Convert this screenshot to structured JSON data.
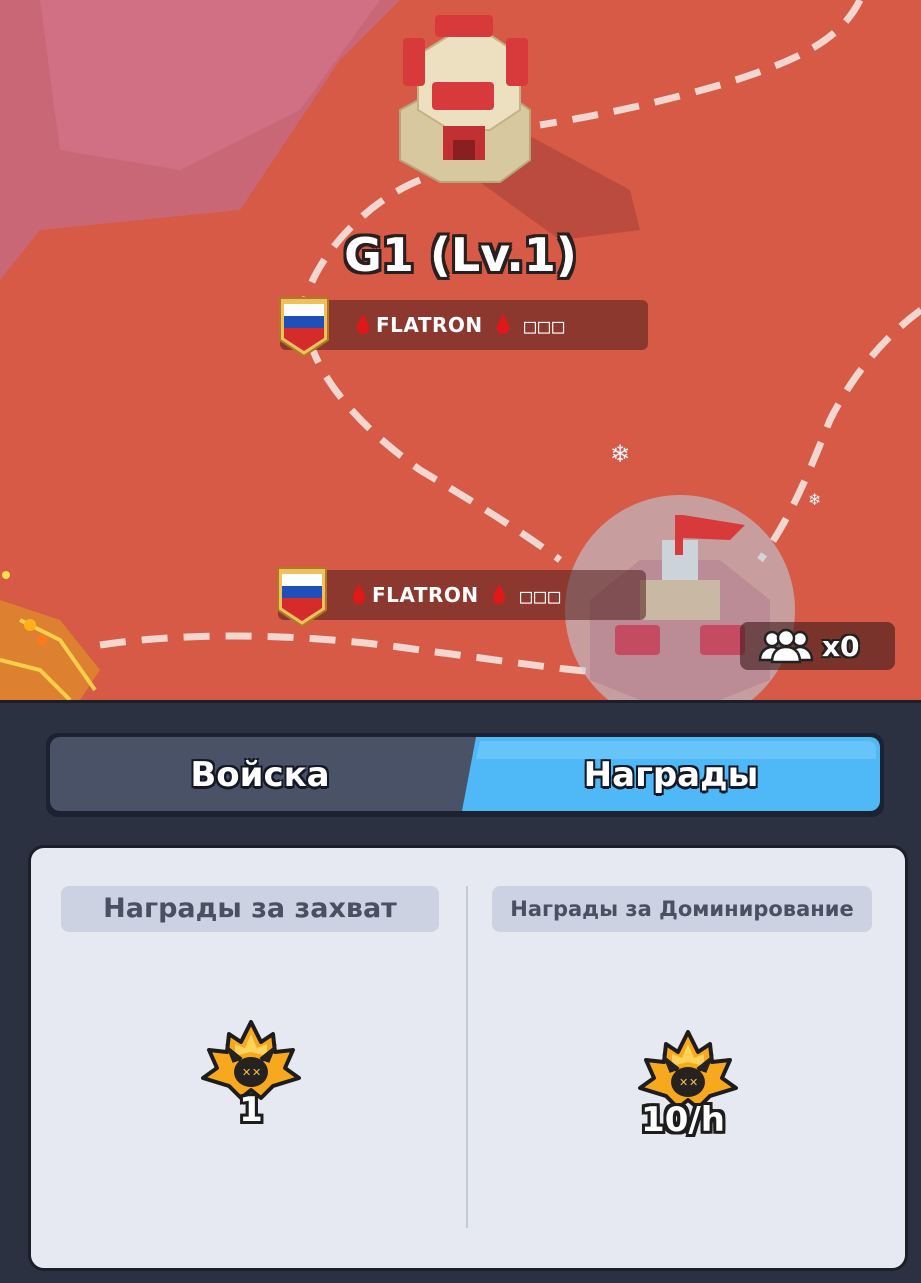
{
  "map": {
    "title": "G1 (Lv.1)",
    "owner_rows": [
      {
        "player": "FLATRON",
        "suffix": "□□□",
        "flag": "russia-flag-icon"
      },
      {
        "player": "FLATRON",
        "suffix": "□□□",
        "flag": "russia-flag-icon"
      }
    ],
    "troops": {
      "icon": "people-icon",
      "count": "x0"
    }
  },
  "tabs": [
    {
      "label": "Войска",
      "active": false
    },
    {
      "label": "Награды",
      "active": true
    }
  ],
  "rewards": {
    "capture": {
      "header": "Награды за захват",
      "icon": "demon-crest-icon",
      "value": "1"
    },
    "domination": {
      "header": "Награды за Доминирование",
      "icon": "demon-crest-icon",
      "value": "10/h"
    }
  },
  "colors": {
    "map_red": "#d65a45",
    "active_tab": "#4fb8f7",
    "inactive_tab": "#4a5268",
    "panel_bg": "#2b3140",
    "card_bg": "#e6e9f1"
  }
}
